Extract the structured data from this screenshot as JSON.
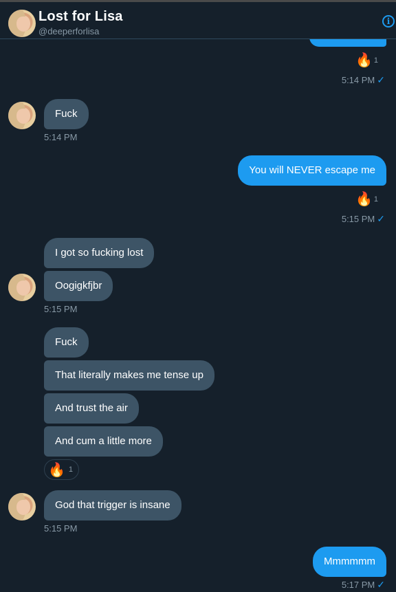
{
  "header": {
    "title": "Lost for Lisa",
    "handle": "@deeperforlisa",
    "info_icon": "i"
  },
  "icons": {
    "reaction": "🔥",
    "read_receipt": "✓"
  },
  "messages": {
    "m0_react_count": "1",
    "m0_time": "5:14 PM",
    "m1_text": "Fuck",
    "m1_time": "5:14 PM",
    "m2_text": "You will NEVER escape me",
    "m2_react_count": "1",
    "m2_time": "5:15 PM",
    "m3_text": "I got so fucking lost",
    "m4_text": "Oogigkfjbr",
    "m4_time": "5:15 PM",
    "m5_text": "Fuck",
    "m6_text": "That literally makes me tense up",
    "m7_text": "And trust the air",
    "m8_text": "And cum a little more",
    "m8_react_count": "1",
    "m9_text": "God that trigger is insane",
    "m9_time": "5:15 PM",
    "m10_text": "Mmmmmm",
    "m10_time": "5:17 PM"
  },
  "colors": {
    "background": "#15202b",
    "incoming_bubble": "#3d5466",
    "outgoing_bubble": "#1d9bf0",
    "muted_text": "#8899a6"
  }
}
